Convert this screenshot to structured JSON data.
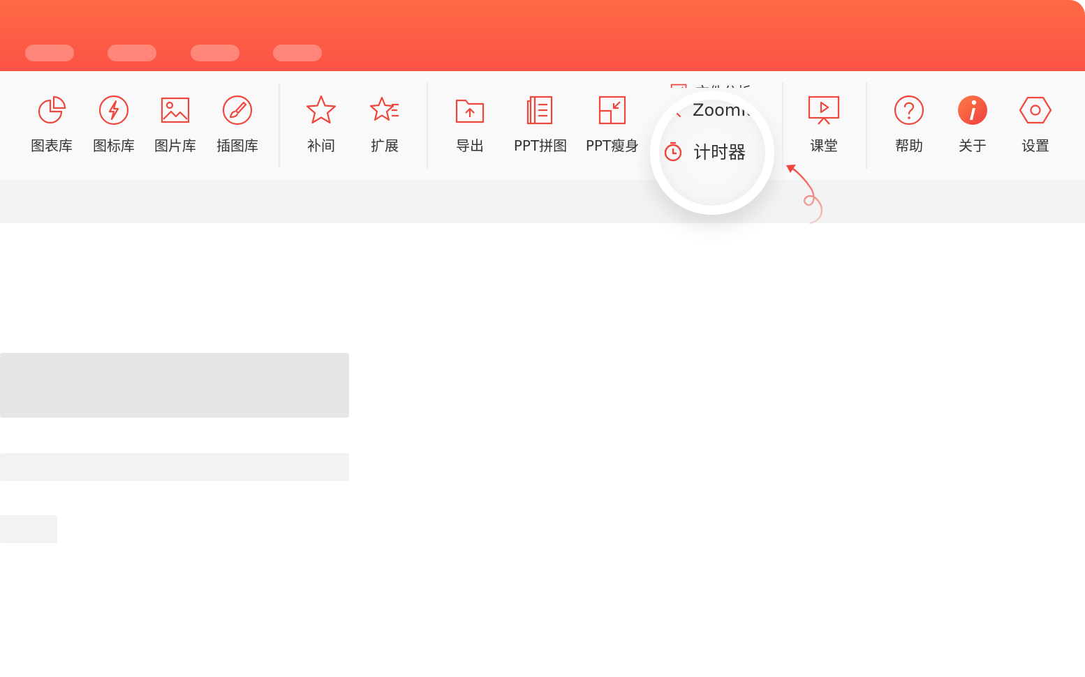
{
  "theme": {
    "accent": "#f0463c",
    "titlebar_gradient": [
      "#ff6a45",
      "#fb5246"
    ],
    "ribbon_bg": "#f9f9f9",
    "subbar_bg": "#f3f3f3",
    "text": "#333333"
  },
  "titlebar": {
    "tabs": [
      "tab-1",
      "tab-2",
      "tab-3",
      "tab-4"
    ]
  },
  "ribbon": {
    "partial_first_label": "库",
    "group_library": [
      {
        "label": "图表库",
        "icon": "pie-chart-icon"
      },
      {
        "label": "图标库",
        "icon": "lightning-icon"
      },
      {
        "label": "图片库",
        "icon": "image-icon"
      },
      {
        "label": "插图库",
        "icon": "brush-icon"
      }
    ],
    "group_animation": [
      {
        "label": "补间",
        "icon": "star-icon"
      },
      {
        "label": "扩展",
        "icon": "star-lines-icon"
      }
    ],
    "group_file": [
      {
        "label": "导出",
        "icon": "folder-upload-icon"
      },
      {
        "label": "PPT拼图",
        "icon": "document-list-icon"
      },
      {
        "label": "PPT瘦身",
        "icon": "compress-icon"
      }
    ],
    "small_tools": {
      "text_analysis": "文件分析",
      "zoomit": "ZoomIt",
      "timer": "计时器"
    },
    "group_class": [
      {
        "label": "课堂",
        "icon": "presentation-icon"
      }
    ],
    "group_help": [
      {
        "label": "帮助",
        "icon": "question-icon"
      },
      {
        "label": "关于",
        "icon": "info-icon"
      },
      {
        "label": "设置",
        "icon": "settings-hexagon-icon"
      }
    ]
  }
}
